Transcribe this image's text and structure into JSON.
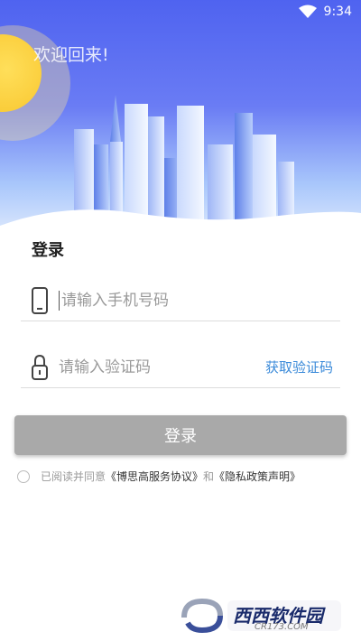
{
  "status_bar": {
    "time": "9:34"
  },
  "hero": {
    "welcome": "欢迎回来!"
  },
  "login": {
    "title": "登录",
    "phone_placeholder": "请输入手机号码",
    "code_placeholder": "请输入验证码",
    "get_code": "获取验证码",
    "submit": "登录"
  },
  "agreement": {
    "prefix": "已阅读并同意",
    "service_link": "《博思高服务协议》",
    "conjunction": "和",
    "privacy_link": "《隐私政策声明》"
  },
  "watermark": {
    "name": "西西软件园",
    "domain": "CR173.COM"
  },
  "colors": {
    "accent": "#3a8ad9",
    "button_disabled": "#a9a9a9",
    "hero_top": "#4f63f0"
  }
}
